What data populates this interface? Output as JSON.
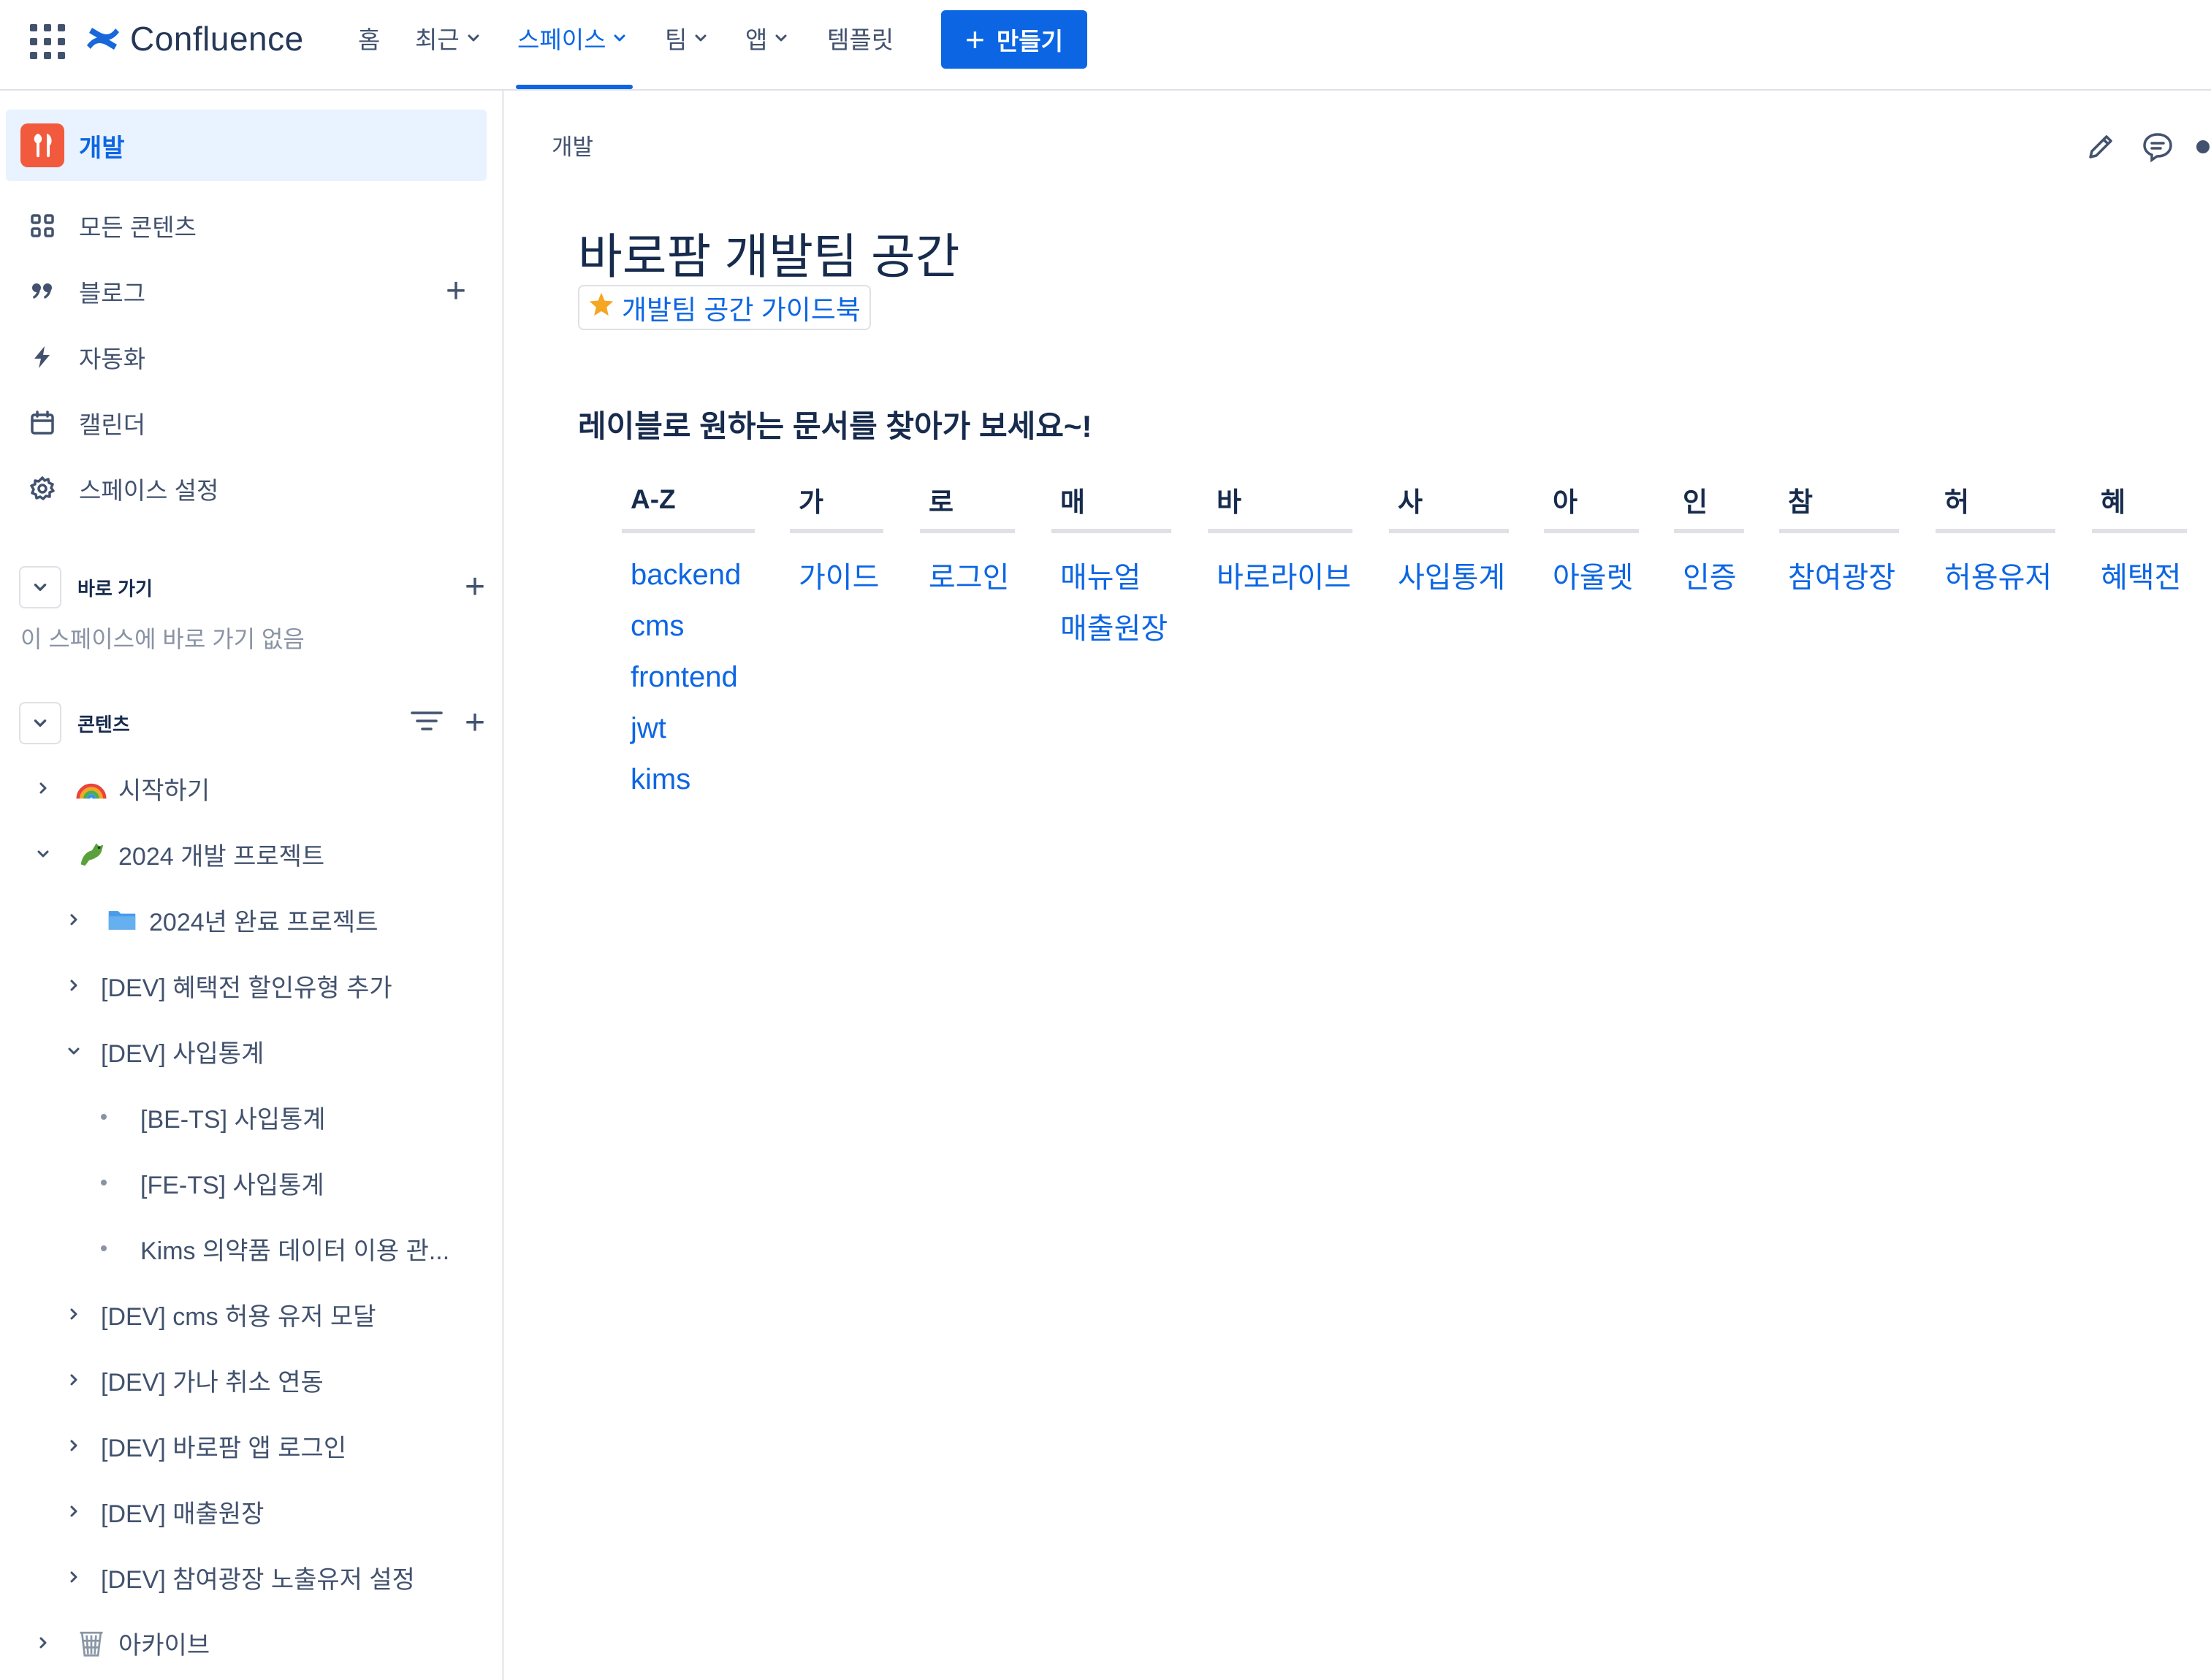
{
  "topnav": {
    "product_name": "Confluence",
    "items": [
      {
        "label": "홈"
      },
      {
        "label": "최근"
      },
      {
        "label": "스페이스"
      },
      {
        "label": "팀"
      },
      {
        "label": "앱"
      },
      {
        "label": "템플릿"
      }
    ],
    "create_label": "만들기",
    "accent": "#0c66e4"
  },
  "sidebar": {
    "space_name": "개발",
    "nav": [
      {
        "label": "모든 콘텐츠",
        "icon": "grid-icon"
      },
      {
        "label": "블로그",
        "icon": "quote-icon"
      },
      {
        "label": "자동화",
        "icon": "lightning-icon"
      },
      {
        "label": "캘린더",
        "icon": "calendar-icon"
      },
      {
        "label": "스페이스 설정",
        "icon": "gear-icon"
      }
    ],
    "shortcuts_title": "바로 가기",
    "shortcuts_empty": "이 스페이스에 바로 가기 없음",
    "content_title": "콘텐츠",
    "tree": [
      {
        "label": "시작하기",
        "icon": "rainbow-icon"
      },
      {
        "label": "2024 개발 프로젝트",
        "icon": "dragon-icon"
      },
      {
        "label": "2024년 완료 프로젝트",
        "icon": "folder-icon"
      },
      {
        "label": "[DEV] 혜택전 할인유형 추가"
      },
      {
        "label": "[DEV] 사입통계"
      },
      {
        "label": "[BE-TS] 사입통계"
      },
      {
        "label": "[FE-TS] 사입통계"
      },
      {
        "label": "Kims 의약품 데이터 이용 관..."
      },
      {
        "label": "[DEV] cms 허용 유저 모달"
      },
      {
        "label": "[DEV] 가나 취소 연동"
      },
      {
        "label": "[DEV] 바로팜 앱 로그인"
      },
      {
        "label": "[DEV] 매출원장"
      },
      {
        "label": "[DEV] 참여광장 노출유저 설정"
      },
      {
        "label": "아카이브",
        "icon": "trash-icon"
      }
    ]
  },
  "main": {
    "breadcrumb": "개발",
    "title": "바로팜 개발팀 공간",
    "guide_link": "개발팀 공간 가이드북",
    "label_heading": "레이블로 원하는 문서를 찾아가 보세요~!",
    "label_columns": [
      {
        "head": "A-Z",
        "items": [
          "backend",
          "cms",
          "frontend",
          "jwt",
          "kims"
        ]
      },
      {
        "head": "가",
        "items": [
          "가이드"
        ]
      },
      {
        "head": "로",
        "items": [
          "로그인"
        ]
      },
      {
        "head": "매",
        "items": [
          "매뉴얼",
          "매출원장"
        ]
      },
      {
        "head": "바",
        "items": [
          "바로라이브"
        ]
      },
      {
        "head": "사",
        "items": [
          "사입통계"
        ]
      },
      {
        "head": "아",
        "items": [
          "아울렛"
        ]
      },
      {
        "head": "인",
        "items": [
          "인증"
        ]
      },
      {
        "head": "참",
        "items": [
          "참여광장"
        ]
      },
      {
        "head": "허",
        "items": [
          "허용유저"
        ]
      },
      {
        "head": "혜",
        "items": [
          "혜택전"
        ]
      }
    ]
  }
}
